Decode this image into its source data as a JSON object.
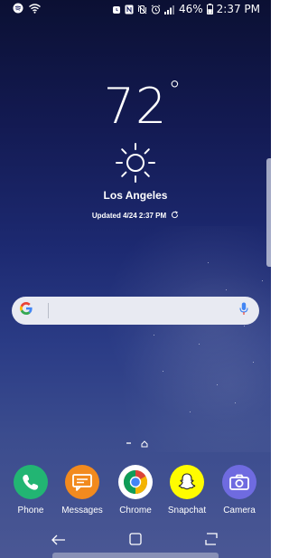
{
  "status_bar": {
    "battery_percent": "46%",
    "time": "2:37 PM",
    "left_icons": [
      "spotify-icon",
      "wifi-icon"
    ],
    "right_icons": [
      "alarm-clock-icon",
      "nfc-icon",
      "vibrate-mute-icon",
      "alarm-icon",
      "signal-bars-icon",
      "battery-icon"
    ]
  },
  "weather": {
    "temperature": "72",
    "degree_symbol": "°",
    "condition_icon": "sun-icon",
    "city": "Los Angeles",
    "updated_text": "Updated 4/24 2:37 PM"
  },
  "search": {
    "placeholder": "",
    "value": "",
    "logo_letter": "G"
  },
  "dock": {
    "apps": [
      {
        "label": "Phone",
        "icon": "phone-icon",
        "color": "#22b573"
      },
      {
        "label": "Messages",
        "icon": "messages-icon",
        "color": "#f28a1e"
      },
      {
        "label": "Chrome",
        "icon": "chrome-icon",
        "color": "#ffffff"
      },
      {
        "label": "Snapchat",
        "icon": "snapchat-icon",
        "color": "#fffc00"
      },
      {
        "label": "Camera",
        "icon": "camera-icon",
        "color": "#6f6be0"
      }
    ]
  },
  "navigation": {
    "buttons": [
      "back-icon",
      "home-button-icon",
      "recents-icon"
    ]
  },
  "colors": {
    "wallpaper_top": "#0b1033",
    "wallpaper_bottom": "#4a5794",
    "search_background": "#e8eaf2",
    "mic_blue": "#4285f4"
  }
}
